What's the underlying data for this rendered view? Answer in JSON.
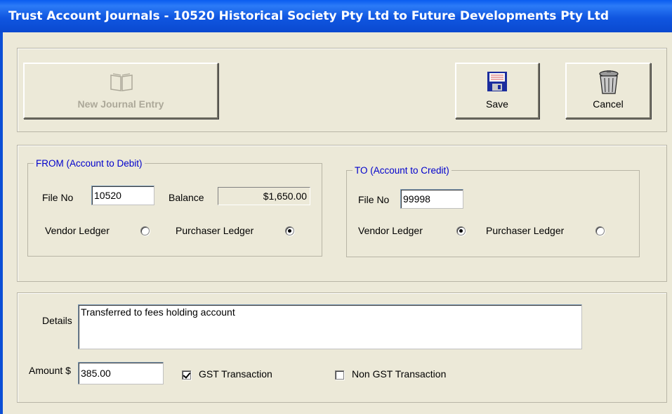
{
  "window": {
    "title": "Trust Account Journals - 10520 Historical Society Pty Ltd to Future Developments Pty Ltd"
  },
  "toolbar": {
    "new_entry_label": "New Journal Entry",
    "new_entry_icon": "open-book-icon",
    "new_entry_enabled": false,
    "save_label": "Save",
    "save_icon": "floppy-disk-icon",
    "cancel_label": "Cancel",
    "cancel_icon": "trash-can-icon"
  },
  "from": {
    "legend": "FROM  (Account to Debit)",
    "file_no_label": "File No",
    "file_no_value": "10520",
    "balance_label": "Balance",
    "balance_value": "$1,650.00",
    "vendor_label": "Vendor Ledger",
    "vendor_selected": false,
    "purchaser_label": "Purchaser Ledger",
    "purchaser_selected": true
  },
  "to": {
    "legend": "TO  (Account to Credit)",
    "file_no_label": "File No",
    "file_no_value": "99998",
    "vendor_label": "Vendor Ledger",
    "vendor_selected": true,
    "purchaser_label": "Purchaser Ledger",
    "purchaser_selected": false
  },
  "details": {
    "label": "Details",
    "value": "Transferred to fees holding account"
  },
  "amount": {
    "label": "Amount $",
    "value": "385.00"
  },
  "gst": {
    "label": "GST Transaction",
    "checked": true
  },
  "non_gst": {
    "label": "Non GST Transaction",
    "checked": false
  },
  "colors": {
    "titlebar": "#0a49d0",
    "window_bg": "#ece9d8",
    "legend_text": "#0000cc",
    "disabled_text": "#aca899"
  }
}
